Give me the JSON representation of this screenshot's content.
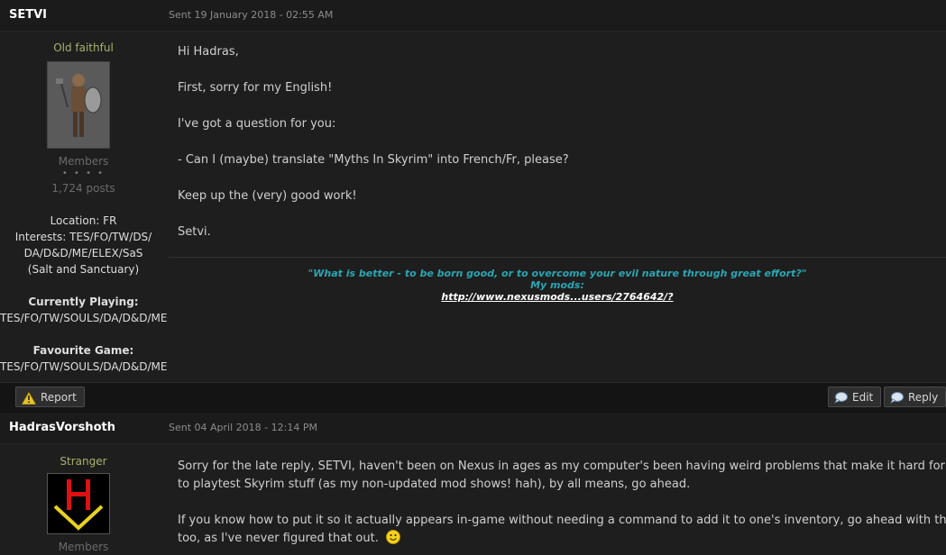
{
  "posts": [
    {
      "author": "SETVI",
      "sent": "Sent 19 January 2018 - 02:55 AM",
      "rank": "Old faithful",
      "group": "Members",
      "pips": "• • • •",
      "post_count": "1,724 posts",
      "location": "Location: FR",
      "interests": [
        "Interests: TES/FO/TW/DS/",
        "DA/D&D/ME/ELEX/SaS",
        "(Salt and Sanctuary)"
      ],
      "currently_playing_label": "Currently Playing:",
      "currently_playing": "TES/FO/TW/SOULS/DA/D&D/ME",
      "favourite_label": "Favourite Game:",
      "favourite": "TES/FO/TW/SOULS/DA/D&D/ME",
      "body": [
        "Hi Hadras,",
        "First, sorry for my English!",
        "I've got a question for you:",
        "- Can I (maybe) translate \"Myths In Skyrim\" into French/Fr, please?",
        "Keep up the (very) good work!",
        "Setvi."
      ],
      "signature": {
        "quote": "\"What is better - to be born good, or to overcome your evil nature through great effort?\"",
        "mods_label": "My mods:",
        "link": "http://www.nexusmods...users/2764642/?"
      }
    },
    {
      "author": "HadrasVorshoth",
      "sent": "Sent 04 April 2018 - 12:14 PM",
      "rank": "Stranger",
      "group": "Members",
      "body": [
        "Sorry for the late reply, SETVI, haven't been on Nexus in ages as my computer's been having weird problems that make it hard for me",
        "to playtest Skyrim stuff (as my non-updated mod shows! hah), by all means, go ahead.",
        "If you know how to put it so it actually appears in-game without needing a command to add it to one's inventory, go ahead with that",
        "too, as I've never figured that out."
      ]
    }
  ],
  "toolbar": {
    "report_label": "Report",
    "edit_label": "Edit",
    "reply_label": "Reply"
  },
  "icons": {
    "report": "warning-icon",
    "edit": "speech-bubble-icon",
    "reply": "speech-bubble-icon",
    "smiley": "smiley-icon"
  },
  "colors": {
    "accent_quote": "#2aa6b3",
    "rank": "#a9b06c",
    "background": "#1e1e1e"
  }
}
